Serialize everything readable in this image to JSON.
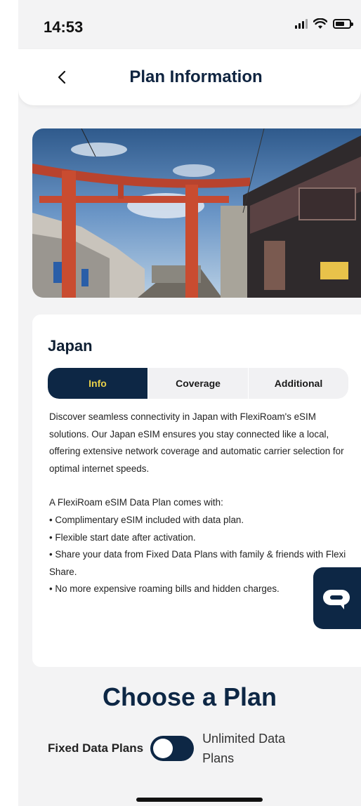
{
  "status_bar": {
    "time": "14:53"
  },
  "header": {
    "title": "Plan Information",
    "back_icon": "chevron-left-icon"
  },
  "hero": {
    "description_icon": "torii-gate-street-photo"
  },
  "plan": {
    "country": "Japan",
    "tabs": [
      {
        "label": "Info",
        "active": true
      },
      {
        "label": "Coverage",
        "active": false
      },
      {
        "label": "Additional",
        "active": false
      }
    ],
    "intro": "Discover seamless connectivity in Japan with FlexiRoam's eSIM solutions. Our Japan eSIM ensures you stay connected like a local, offering extensive network coverage and automatic carrier selection for optimal internet speeds.",
    "list_heading": "A FlexiRoam eSIM Data Plan comes with:",
    "bullets": [
      "• Complimentary eSIM included with data plan.",
      "• Flexible start date after activation.",
      "• Share your data from Fixed Data Plans with family & friends with Flexi Share.",
      "• No more expensive roaming bills and hidden charges."
    ]
  },
  "chat": {
    "icon": "chat-bubble-icon"
  },
  "choose": {
    "title": "Choose a Plan",
    "fixed_label": "Fixed Data Plans",
    "unlimited_label": "Unlimited Data Plans",
    "toggle_on": false
  },
  "colors": {
    "brand_navy": "#0d2745",
    "tab_active_text": "#e8d04a"
  }
}
